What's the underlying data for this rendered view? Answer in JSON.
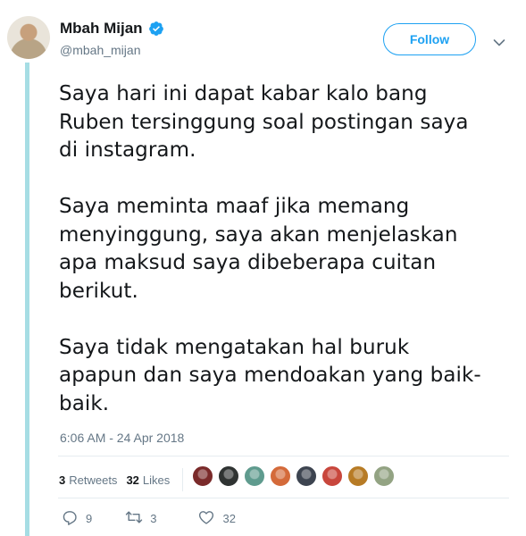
{
  "author": {
    "display_name": "Mbah Mijan",
    "handle": "@mbah_mijan",
    "verified": true
  },
  "follow_button": {
    "label": "Follow"
  },
  "tweet": {
    "text": "Saya hari ini dapat kabar kalo bang\nRuben tersinggung soal postingan saya\ndi instagram.\n\nSaya meminta maaf jika memang\nmenyinggung, saya akan menjelaskan\napa maksud saya dibeberapa cuitan\nberikut.\n\nSaya tidak mengatakan hal buruk\napapun dan saya mendoakan yang baik-\nbaik.",
    "timestamp": "6:06 AM - 24 Apr 2018"
  },
  "stats": {
    "retweets_count": "3",
    "retweets_label": "Retweets",
    "likes_count": "32",
    "likes_label": "Likes"
  },
  "likers": [
    {
      "color": "#7a2a2a"
    },
    {
      "color": "#2f3332"
    },
    {
      "color": "#5f9b8e"
    },
    {
      "color": "#d46a3a"
    },
    {
      "color": "#3d4450"
    },
    {
      "color": "#c8463c"
    },
    {
      "color": "#b77b25"
    },
    {
      "color": "#93a383"
    }
  ],
  "actions": {
    "reply_count": "9",
    "retweet_count": "3",
    "like_count": "32"
  },
  "colors": {
    "accent": "#1da1f2",
    "thread_line": "#a6dde4",
    "secondary_text": "#657786"
  }
}
